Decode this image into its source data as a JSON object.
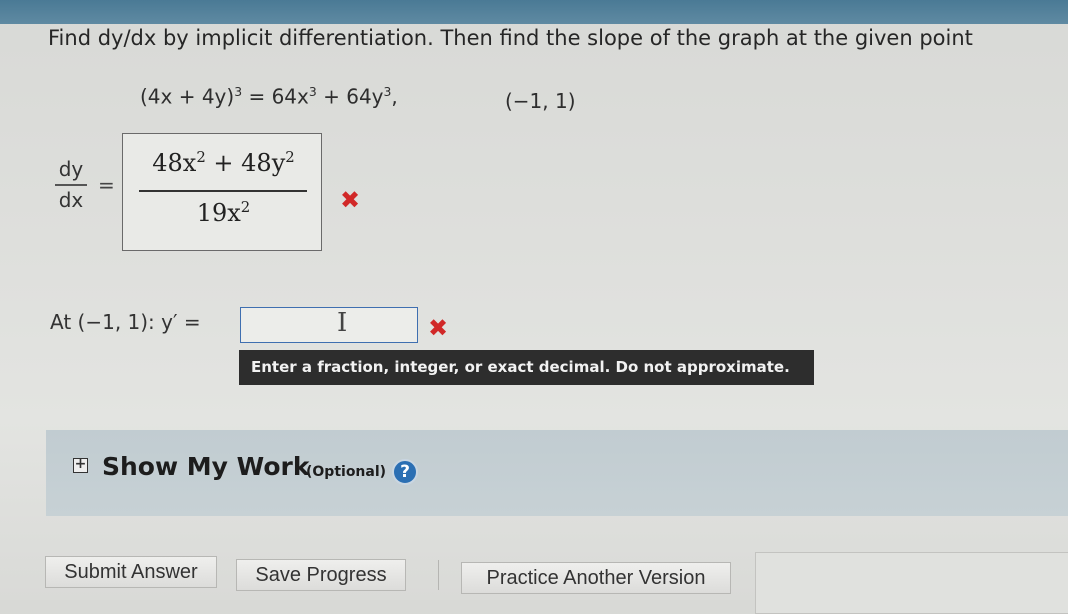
{
  "question": {
    "prompt": "Find dy/dx by implicit differentiation. Then find the slope of the graph at the given point",
    "equation": {
      "lhs": "(4x + 4y)",
      "lhs_exp": "3",
      "mid": " = 64x",
      "mid_exp": "3",
      "rhs": " + 64y",
      "rhs_exp": "3",
      "trail": ","
    },
    "point": "(−1, 1)"
  },
  "derivative": {
    "label_numerator": "dy",
    "label_denominator": "dx",
    "equals": "=",
    "answer_numerator": {
      "a": "48x",
      "a_exp": "2",
      "b": " + 48y",
      "b_exp": "2"
    },
    "answer_denominator": {
      "a": "19x",
      "a_exp": "2"
    },
    "status": "incorrect",
    "status_glyph": "✖"
  },
  "slope": {
    "label": "At (−1, 1): y′ =",
    "input_value": "",
    "cursor_glyph": "I",
    "status_glyph": "✖",
    "tooltip": "Enter a fraction, integer, or exact decimal. Do not approximate."
  },
  "show_my_work": {
    "expand_glyph": "+",
    "title": "Show My Work",
    "optional": "(Optional)",
    "help_glyph": "?"
  },
  "buttons": {
    "submit": "Submit Answer",
    "save": "Save Progress",
    "practice": "Practice Another Version"
  },
  "colors": {
    "error_red": "#d12828",
    "help_blue": "#2b6fb3",
    "band": "#c4ced3"
  }
}
